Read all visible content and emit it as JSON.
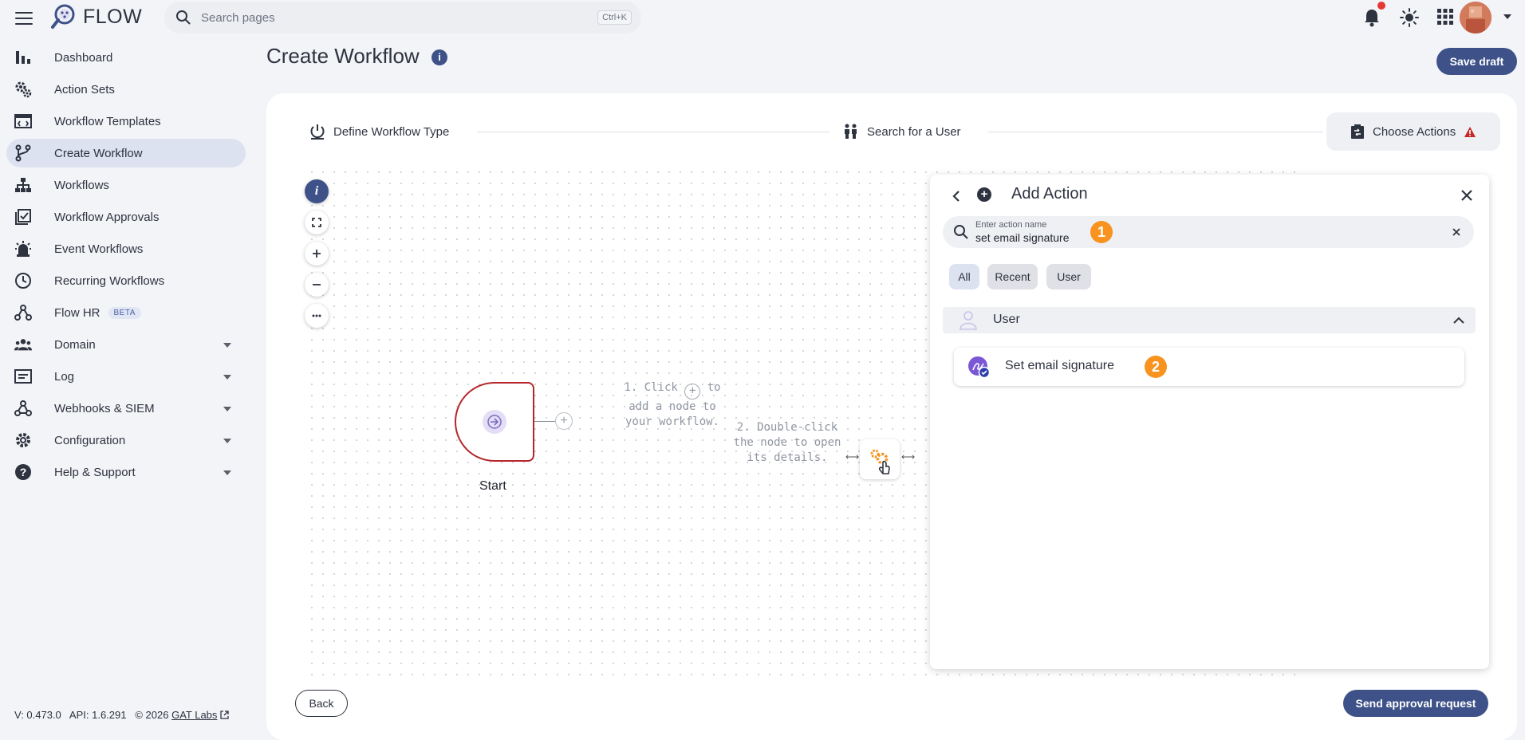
{
  "app": {
    "name": "FLOW"
  },
  "search": {
    "placeholder": "Search pages",
    "shortcut": "Ctrl+K"
  },
  "sidebar": {
    "items": [
      {
        "label": "Dashboard",
        "icon": "bar-chart-icon"
      },
      {
        "label": "Action Sets",
        "icon": "gears-icon"
      },
      {
        "label": "Workflow Templates",
        "icon": "template-icon"
      },
      {
        "label": "Create Workflow",
        "icon": "branch-icon",
        "active": true
      },
      {
        "label": "Workflows",
        "icon": "hierarchy-icon"
      },
      {
        "label": "Workflow Approvals",
        "icon": "approval-icon"
      },
      {
        "label": "Event Workflows",
        "icon": "alarm-icon"
      },
      {
        "label": "Recurring Workflows",
        "icon": "clock-icon"
      },
      {
        "label": "Flow HR",
        "icon": "hr-icon",
        "badge": "BETA"
      },
      {
        "label": "Domain",
        "icon": "people-icon",
        "expandable": true
      },
      {
        "label": "Log",
        "icon": "log-icon",
        "expandable": true
      },
      {
        "label": "Webhooks & SIEM",
        "icon": "webhook-icon",
        "expandable": true
      },
      {
        "label": "Configuration",
        "icon": "settings-icon",
        "expandable": true
      },
      {
        "label": "Help & Support",
        "icon": "help-icon",
        "expandable": true
      }
    ]
  },
  "footer": {
    "version": "V: 0.473.0",
    "api": "API: 1.6.291",
    "copyright": "© 2026",
    "company_link": "GAT Labs"
  },
  "page": {
    "title": "Create Workflow",
    "save_draft": "Save draft"
  },
  "stepper": {
    "steps": [
      {
        "label": "Define Workflow Type"
      },
      {
        "label": "Search for a User"
      },
      {
        "label": "Choose Actions",
        "warning": true
      }
    ]
  },
  "canvas": {
    "start_label": "Start",
    "hint1": [
      "1. Click",
      "to",
      "add a node to",
      "your workflow."
    ],
    "hint2": [
      "2. Double-click",
      "the node to open",
      "its details."
    ],
    "info_button": "i"
  },
  "add_action": {
    "title": "Add Action",
    "search_label": "Enter action name",
    "search_value": "set email signature",
    "step_badge_1": "1",
    "filters": [
      "All",
      "Recent",
      "User"
    ],
    "active_filter": "All",
    "group": "User",
    "action": "Set email signature",
    "step_badge_2": "2"
  },
  "buttons": {
    "back": "Back",
    "send_approval": "Send approval request"
  },
  "colors": {
    "primary": "#3e5289",
    "accent_badge": "#f7931e",
    "start_border": "#b5262a",
    "warning": "#c62828"
  }
}
